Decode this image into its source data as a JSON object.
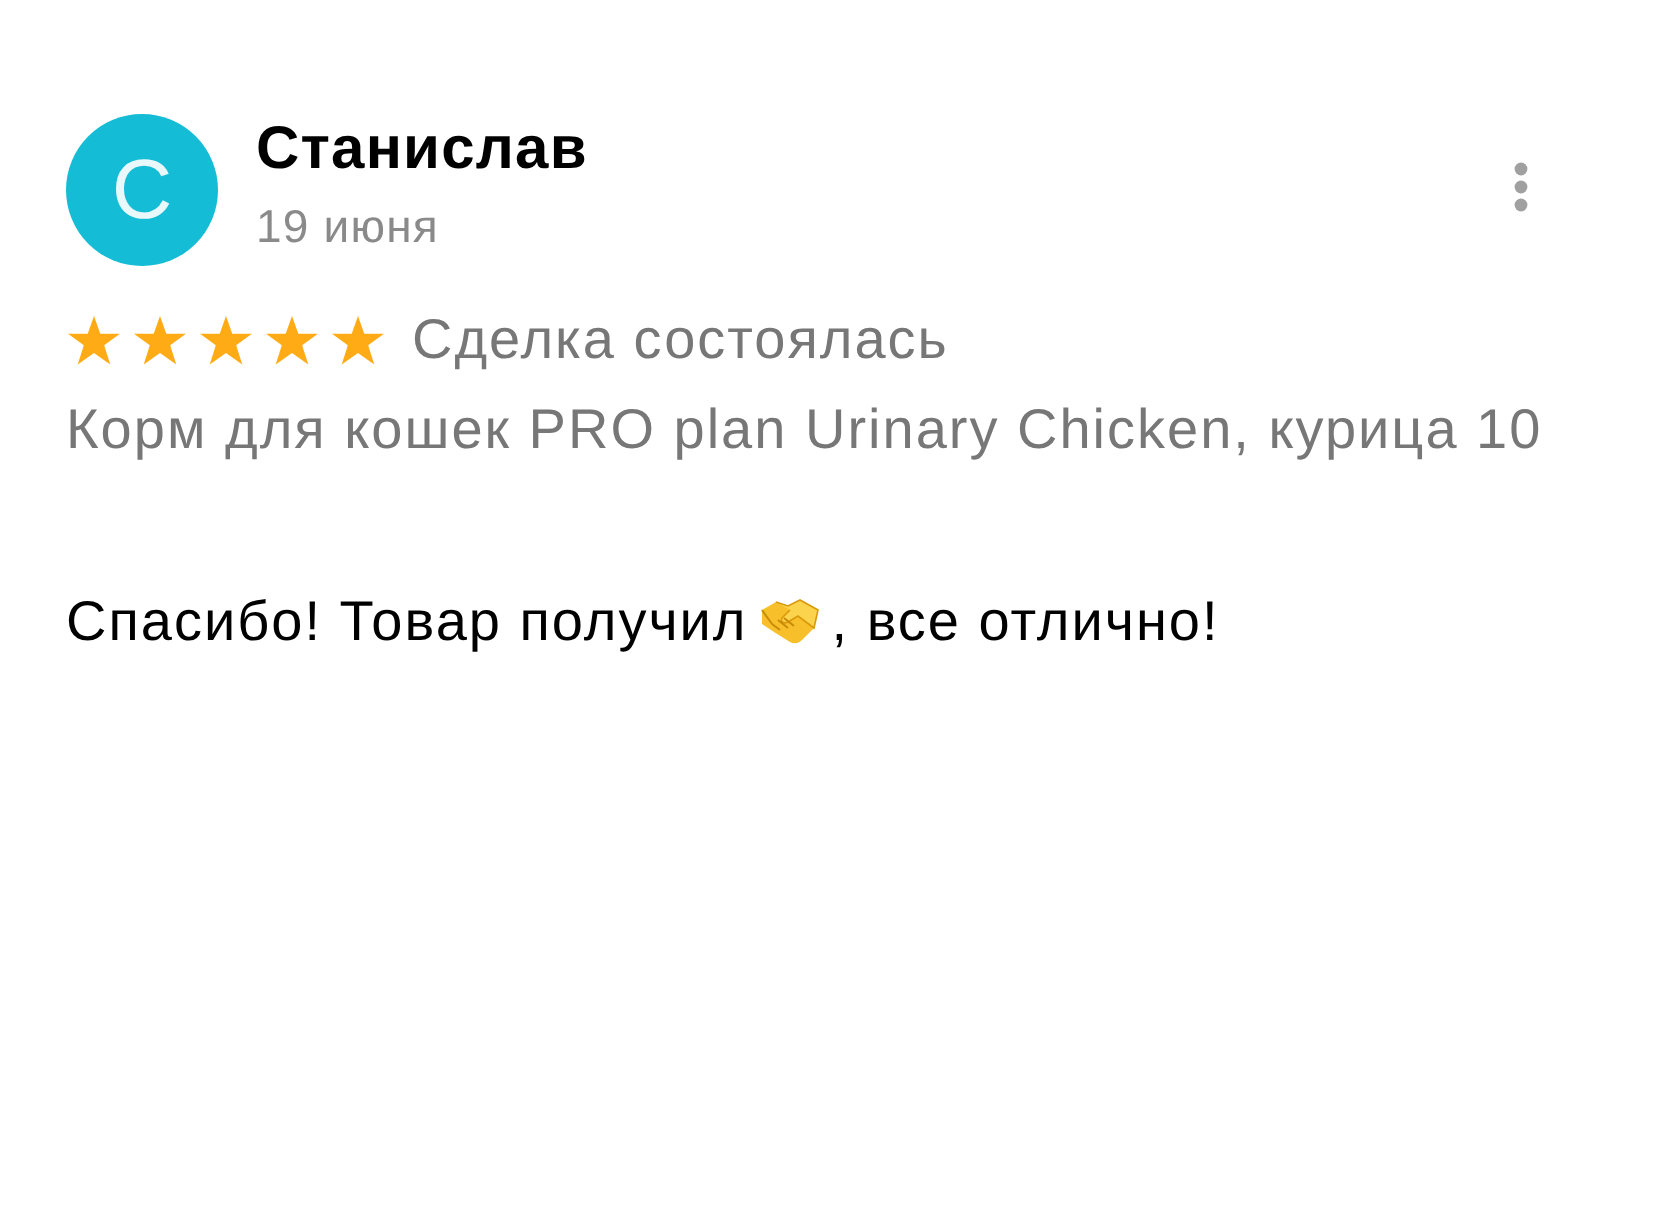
{
  "author": {
    "avatar_letter": "С",
    "name": "Станислав",
    "date": "19 июня"
  },
  "rating": {
    "stars": 5,
    "status": "Сделка состоялась"
  },
  "product": "Корм для кошек PRO plan Urinary Chicken, курица 10",
  "review": [
    {
      "kind": "text",
      "text": "Спасибо! Товар получил"
    },
    {
      "kind": "emoji"
    },
    {
      "kind": "text",
      "text": ", все отлично!"
    }
  ]
}
